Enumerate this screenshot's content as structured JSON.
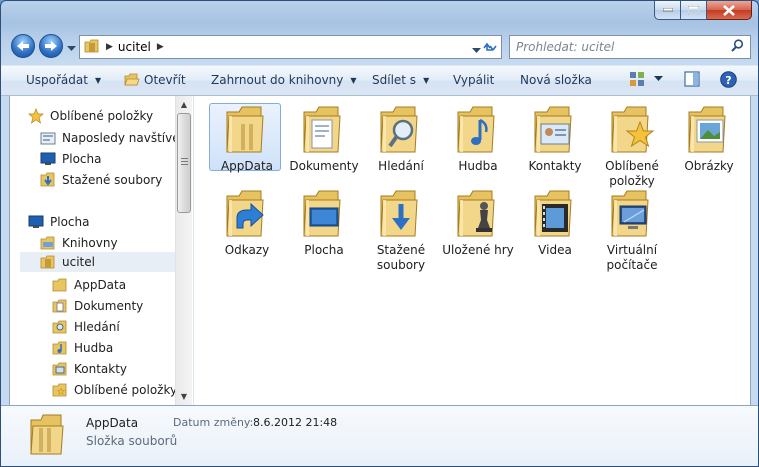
{
  "window": {
    "icons": {
      "minimize": "minimize-icon",
      "maximize": "maximize-icon",
      "close": "close-icon"
    },
    "close_color": "#c8432a"
  },
  "address_bar": {
    "path": "ucitel",
    "search_placeholder": "Prohledat: ucitel"
  },
  "toolbar": {
    "organize": "Uspořádat",
    "open": "Otevřít",
    "include_in_library": "Zahrnout do knihovny",
    "share_with": "Sdílet s",
    "burn": "Vypálit",
    "new_folder": "Nová složka"
  },
  "nav_pane": {
    "favorites": {
      "header": "Oblíbené položky",
      "items": [
        "Naposledy navštívené",
        "Plocha",
        "Stažené soubory"
      ]
    },
    "desktop": {
      "header": "Plocha",
      "items": [
        {
          "label": "Knihovny",
          "level": 1
        },
        {
          "label": "ucitel",
          "level": 1,
          "selected": true
        },
        {
          "label": "AppData",
          "level": 2
        },
        {
          "label": "Dokumenty",
          "level": 2
        },
        {
          "label": "Hledání",
          "level": 2
        },
        {
          "label": "Hudba",
          "level": 2
        },
        {
          "label": "Kontakty",
          "level": 2
        },
        {
          "label": "Oblíbené položky",
          "level": 2
        }
      ]
    }
  },
  "items": [
    {
      "name": "AppData",
      "line2": "",
      "icon": "appdata-folder-icon",
      "selected": true
    },
    {
      "name": "Dokumenty",
      "line2": "",
      "icon": "documents-folder-icon"
    },
    {
      "name": "Hledání",
      "line2": "",
      "icon": "searches-folder-icon"
    },
    {
      "name": "Hudba",
      "line2": "",
      "icon": "music-folder-icon"
    },
    {
      "name": "Kontakty",
      "line2": "",
      "icon": "contacts-folder-icon"
    },
    {
      "name": "Oblíbené",
      "line2": "položky",
      "icon": "favorites-folder-icon"
    },
    {
      "name": "Obrázky",
      "line2": "",
      "icon": "pictures-folder-icon"
    },
    {
      "name": "Odkazy",
      "line2": "",
      "icon": "links-folder-icon"
    },
    {
      "name": "Plocha",
      "line2": "",
      "icon": "desktop-folder-icon"
    },
    {
      "name": "Stažené",
      "line2": "soubory",
      "icon": "downloads-folder-icon"
    },
    {
      "name": "Uložené hry",
      "line2": "",
      "icon": "saved-games-folder-icon"
    },
    {
      "name": "Videa",
      "line2": "",
      "icon": "videos-folder-icon"
    },
    {
      "name": "Virtuální",
      "line2": "počítače",
      "icon": "virtual-machines-folder-icon"
    }
  ],
  "details": {
    "name": "AppData",
    "type": "Složka souborů",
    "date_label": "Datum změny:",
    "date_value": "8.6.2012 21:48"
  }
}
